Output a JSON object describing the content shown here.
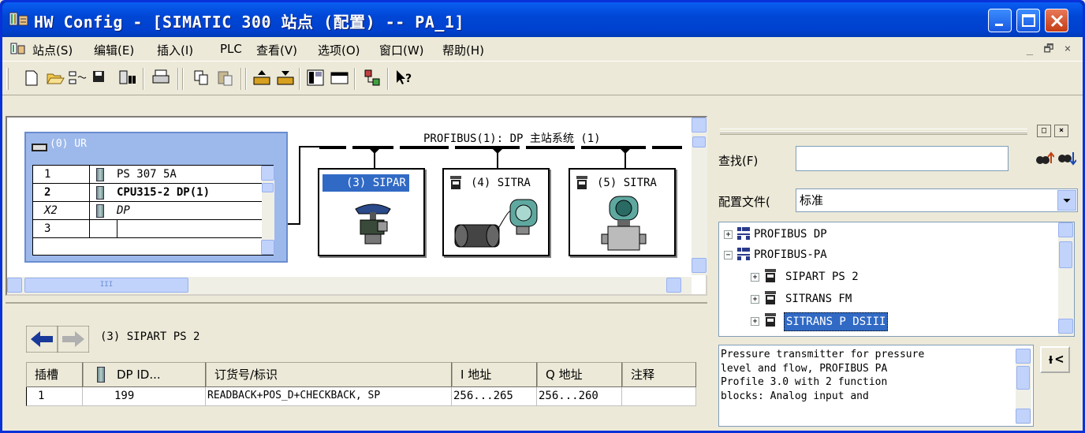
{
  "window": {
    "title": "HW Config - [SIMATIC 300 站点 (配置) -- PA_1]"
  },
  "menu": {
    "items": [
      "站点(S)",
      "编辑(E)",
      "插入(I)",
      "PLC",
      "查看(V)",
      "选项(O)",
      "窗口(W)",
      "帮助(H)"
    ],
    "mdi_buttons": [
      "_",
      "🗗",
      "×"
    ]
  },
  "toolbar": {
    "icons": [
      "new-icon",
      "open-icon",
      "network-icon",
      "save-icon",
      "download-icon",
      "print-icon",
      "copy-icon",
      "paste-icon",
      "catalog-upload-icon",
      "catalog-download-icon",
      "properties-icon",
      "window-icon",
      "network-view-icon",
      "help-pointer-icon"
    ]
  },
  "station": {
    "rack_title": "(0) UR",
    "rows": [
      {
        "slot": "1",
        "module": "PS 307 5A",
        "bold": false,
        "italic": false
      },
      {
        "slot": "2",
        "module": "CPU315-2 DP(1)",
        "bold": true,
        "italic": false
      },
      {
        "slot": "X2",
        "module": "DP",
        "bold": false,
        "italic": true
      },
      {
        "slot": "3",
        "module": "",
        "bold": false,
        "italic": false
      }
    ],
    "dp_label": "PROFIBUS(1): DP 主站系统 (1)",
    "slaves": [
      {
        "label": "(3) SIPAR",
        "selected": true
      },
      {
        "label": "(4) SITRA",
        "selected": false
      },
      {
        "label": "(5) SITRA",
        "selected": false
      }
    ],
    "hscroll_thumb": "III"
  },
  "detail": {
    "title": "(3)   SIPART PS 2",
    "columns": [
      "插槽",
      "DP ID...",
      "订货号/标识",
      "I 地址",
      "Q 地址",
      "注释"
    ],
    "rows": [
      [
        "1",
        "199",
        "READBACK+POS_D+CHECKBACK, SP",
        "256...265",
        "256...260",
        ""
      ]
    ]
  },
  "catalog": {
    "find_label": "查找(F)",
    "find_value": "",
    "profile_label": "配置文件(",
    "profile_value": "标准",
    "tree": [
      {
        "label": "PROFIBUS DP",
        "expander": "+",
        "level": 0,
        "selected": false
      },
      {
        "label": "PROFIBUS-PA",
        "expander": "−",
        "level": 0,
        "selected": false
      },
      {
        "label": "SIPART PS 2",
        "expander": "+",
        "level": 1,
        "selected": false
      },
      {
        "label": "SITRANS FM",
        "expander": "+",
        "level": 1,
        "selected": false
      },
      {
        "label": "SITRANS P DSIII",
        "expander": "+",
        "level": 1,
        "selected": true
      }
    ],
    "info_lines": [
      "Pressure transmitter for pressure",
      "level and flow, PROFIBUS PA",
      "Profile 3.0 with 2 function",
      "blocks: Analog input and"
    ],
    "info_button": "ᵼ<"
  }
}
